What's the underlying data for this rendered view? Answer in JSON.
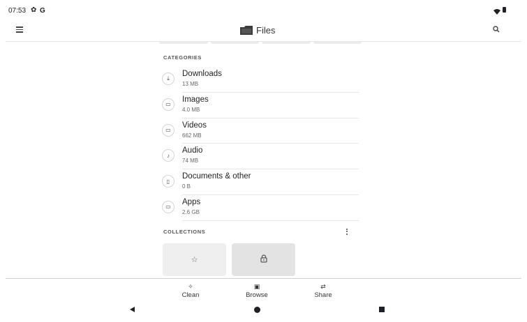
{
  "status_bar": {
    "time": "07:53",
    "gear_glyph": "✿",
    "google_glyph": "G",
    "icons": [
      "settings-icon",
      "google-icon",
      "wifi-icon",
      "battery-icon"
    ]
  },
  "app_bar": {
    "title": "Files",
    "icons": [
      "menu-icon",
      "folder-icon",
      "search-icon"
    ]
  },
  "categories": {
    "header": "CATEGORIES",
    "items": [
      {
        "name": "Downloads",
        "size": "13 MB",
        "icon": "download-icon",
        "glyph": "⤓"
      },
      {
        "name": "Images",
        "size": "4.0 MB",
        "icon": "image-icon",
        "glyph": "▭"
      },
      {
        "name": "Videos",
        "size": "662 MB",
        "icon": "video-icon",
        "glyph": "▭"
      },
      {
        "name": "Audio",
        "size": "74 MB",
        "icon": "audio-icon",
        "glyph": "♪"
      },
      {
        "name": "Documents & other",
        "size": "0 B",
        "icon": "document-icon",
        "glyph": "▯"
      },
      {
        "name": "Apps",
        "size": "2.6 GB",
        "icon": "apps-icon",
        "glyph": "▭"
      }
    ]
  },
  "collections": {
    "header": "COLLECTIONS",
    "cards": [
      {
        "icon": "star-icon",
        "glyph": "☆"
      },
      {
        "icon": "lock-icon",
        "glyph": "🔒︎"
      }
    ]
  },
  "bottom_nav": {
    "items": [
      {
        "label": "Clean",
        "icon": "sparkle-icon",
        "glyph": "✧"
      },
      {
        "label": "Browse",
        "icon": "browse-folder-icon",
        "glyph": "▣"
      },
      {
        "label": "Share",
        "icon": "swap-arrows-icon",
        "glyph": "⇄"
      }
    ]
  },
  "colors": {
    "background": "#ffffff",
    "text_primary": "#1f1f1f",
    "text_secondary": "#666666",
    "card_favorites": "#efefef",
    "card_safe": "#e3e3e3"
  }
}
